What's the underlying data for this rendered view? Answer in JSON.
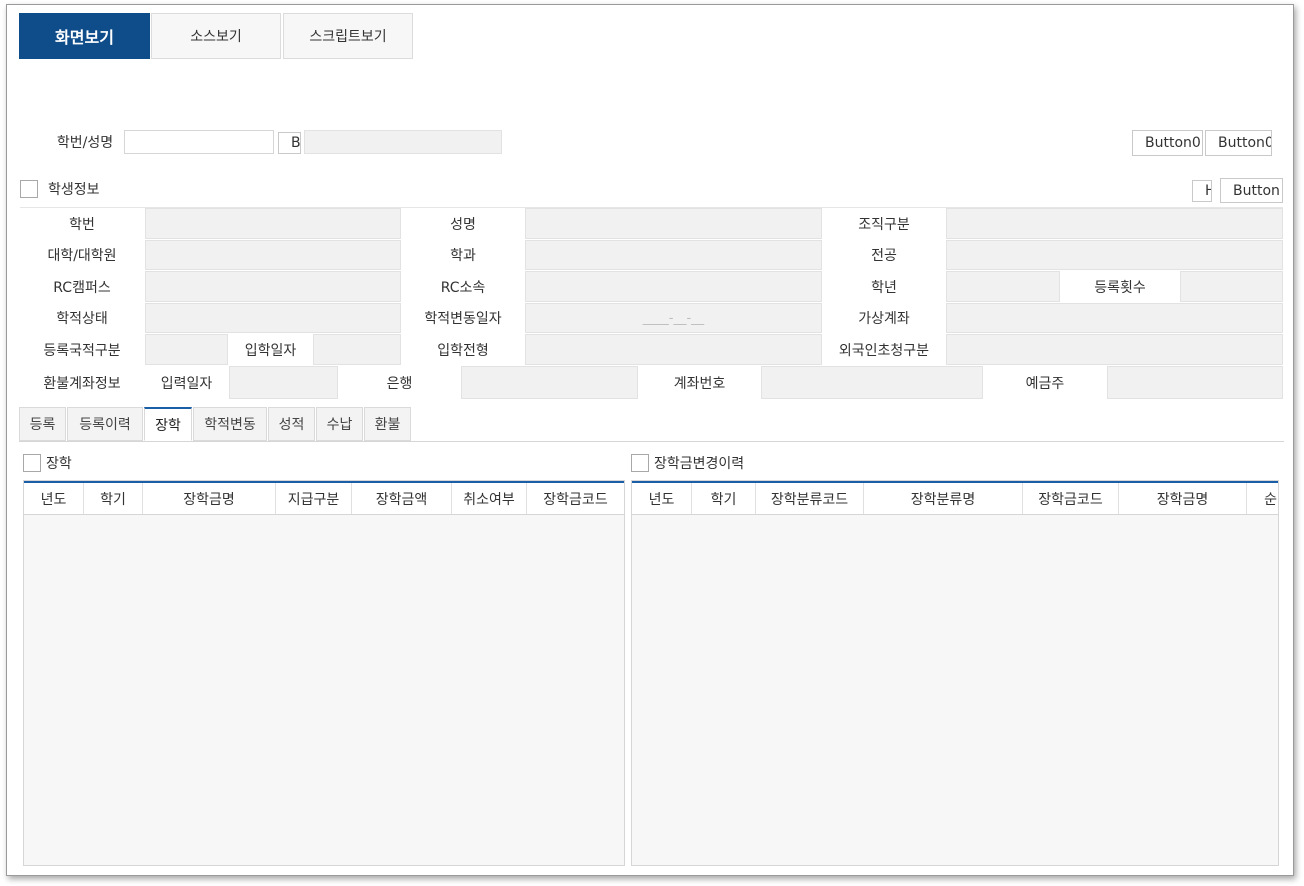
{
  "top_tabs": [
    "화면보기",
    "소스보기",
    "스크립트보기"
  ],
  "search": {
    "label": "학번/성명",
    "input_value": "",
    "button_label": "B",
    "name_value": "",
    "buttons": [
      "Button0",
      "Button0"
    ]
  },
  "student_info": {
    "section_label": "학생정보",
    "small_button": "H",
    "button": "Button",
    "rows": [
      [
        "학번",
        "성명",
        "조직구분"
      ],
      [
        "대학/대학원",
        "학과",
        "전공"
      ],
      [
        "RC캠퍼스",
        "RC소속",
        "학년"
      ],
      [
        "학적상태",
        "학적변동일자",
        "가상계좌"
      ],
      [
        "등록국적구분",
        "입학전형",
        "외국인초청구분"
      ]
    ],
    "registration_count_label": "등록횟수",
    "admission_date_label": "입학일자",
    "change_date_mask": "____-__-__",
    "refund": {
      "label": "환불계좌정보",
      "input_date": "입력일자",
      "bank": "은행",
      "account_no": "계좌번호",
      "depositor": "예금주"
    }
  },
  "sub_tabs": [
    "등록",
    "등록이력",
    "장학",
    "학적변동",
    "성적",
    "수납",
    "환불"
  ],
  "active_sub_tab": "장학",
  "scholarship": {
    "label": "장학",
    "columns": [
      "년도",
      "학기",
      "장학금명",
      "지급구분",
      "장학금액",
      "취소여부",
      "장학금코드"
    ]
  },
  "scholarship_history": {
    "label": "장학금변경이력",
    "columns": [
      "년도",
      "학기",
      "장학분류코드",
      "장학분류명",
      "장학금코드",
      "장학금명",
      "순번"
    ]
  },
  "colors": {
    "accent": "#0f4c8a",
    "grid_border_top": "#1a5ea8"
  }
}
